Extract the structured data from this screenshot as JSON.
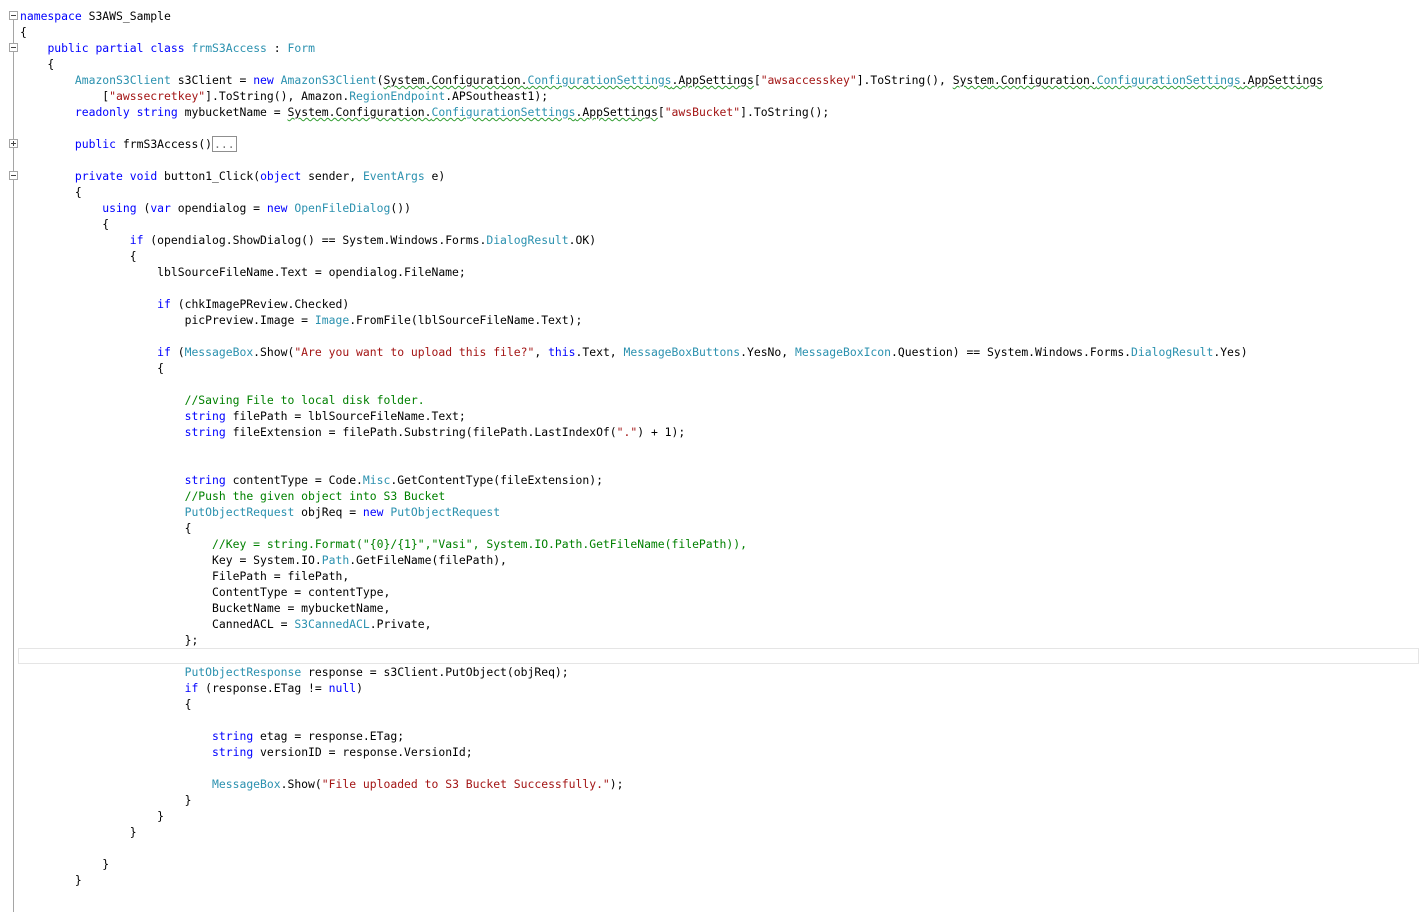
{
  "editor": {
    "name": "code-editor",
    "lines": [
      "namespace S3AWS_Sample",
      "{",
      "    public partial class frmS3Access : Form",
      "    {",
      "        AmazonS3Client s3Client = new AmazonS3Client(System.Configuration.ConfigurationSettings.AppSettings[\"awsaccesskey\"].ToString(), System.Configuration.ConfigurationSettings.AppSettings",
      "            [\"awssecretkey\"].ToString(), Amazon.RegionEndpoint.APSoutheast1);",
      "        readonly string mybucketName = System.Configuration.ConfigurationSettings.AppSettings[\"awsBucket\"].ToString();",
      "",
      "        public frmS3Access()...",
      "",
      "        private void button1_Click(object sender, EventArgs e)",
      "        {",
      "            using (var opendialog = new OpenFileDialog())",
      "            {",
      "                if (opendialog.ShowDialog() == System.Windows.Forms.DialogResult.OK)",
      "                {",
      "                    lblSourceFileName.Text = opendialog.FileName;",
      "",
      "                    if (chkImagePReview.Checked)",
      "                        picPreview.Image = Image.FromFile(lblSourceFileName.Text);",
      "",
      "                    if (MessageBox.Show(\"Are you want to upload this file?\", this.Text, MessageBoxButtons.YesNo, MessageBoxIcon.Question) == System.Windows.Forms.DialogResult.Yes)",
      "                    {",
      "",
      "                        //Saving File to local disk folder.",
      "                        string filePath = lblSourceFileName.Text;",
      "                        string fileExtension = filePath.Substring(filePath.LastIndexOf(\".\") + 1);",
      "",
      "",
      "                        string contentType = Code.Misc.GetContentType(fileExtension);",
      "                        //Push the given object into S3 Bucket",
      "                        PutObjectRequest objReq = new PutObjectRequest",
      "                        {",
      "                            //Key = string.Format(\"{0}/{1}\",\"Vasi\", System.IO.Path.GetFileName(filePath)),",
      "                            Key = System.IO.Path.GetFileName(filePath),",
      "                            FilePath = filePath,",
      "                            ContentType = contentType,",
      "                            BucketName = mybucketName,",
      "                            CannedACL = S3CannedACL.Private,",
      "                        };",
      "",
      "                        PutObjectResponse response = s3Client.PutObject(objReq);",
      "                        if (response.ETag != null)",
      "                        {",
      "",
      "                            string etag = response.ETag;",
      "                            string versionID = response.VersionId;",
      "",
      "                            MessageBox.Show(\"File uploaded to S3 Bucket Successfully.\");",
      "                        }",
      "                    }",
      "                }",
      "",
      "            }",
      "        }"
    ],
    "current_line": 40,
    "collapsed_region_text": "...",
    "colors": {
      "keyword": "#0000ff",
      "type": "#2b91af",
      "string": "#a31515",
      "comment": "#008000",
      "warning_squiggle": "#2e9b2e"
    }
  }
}
